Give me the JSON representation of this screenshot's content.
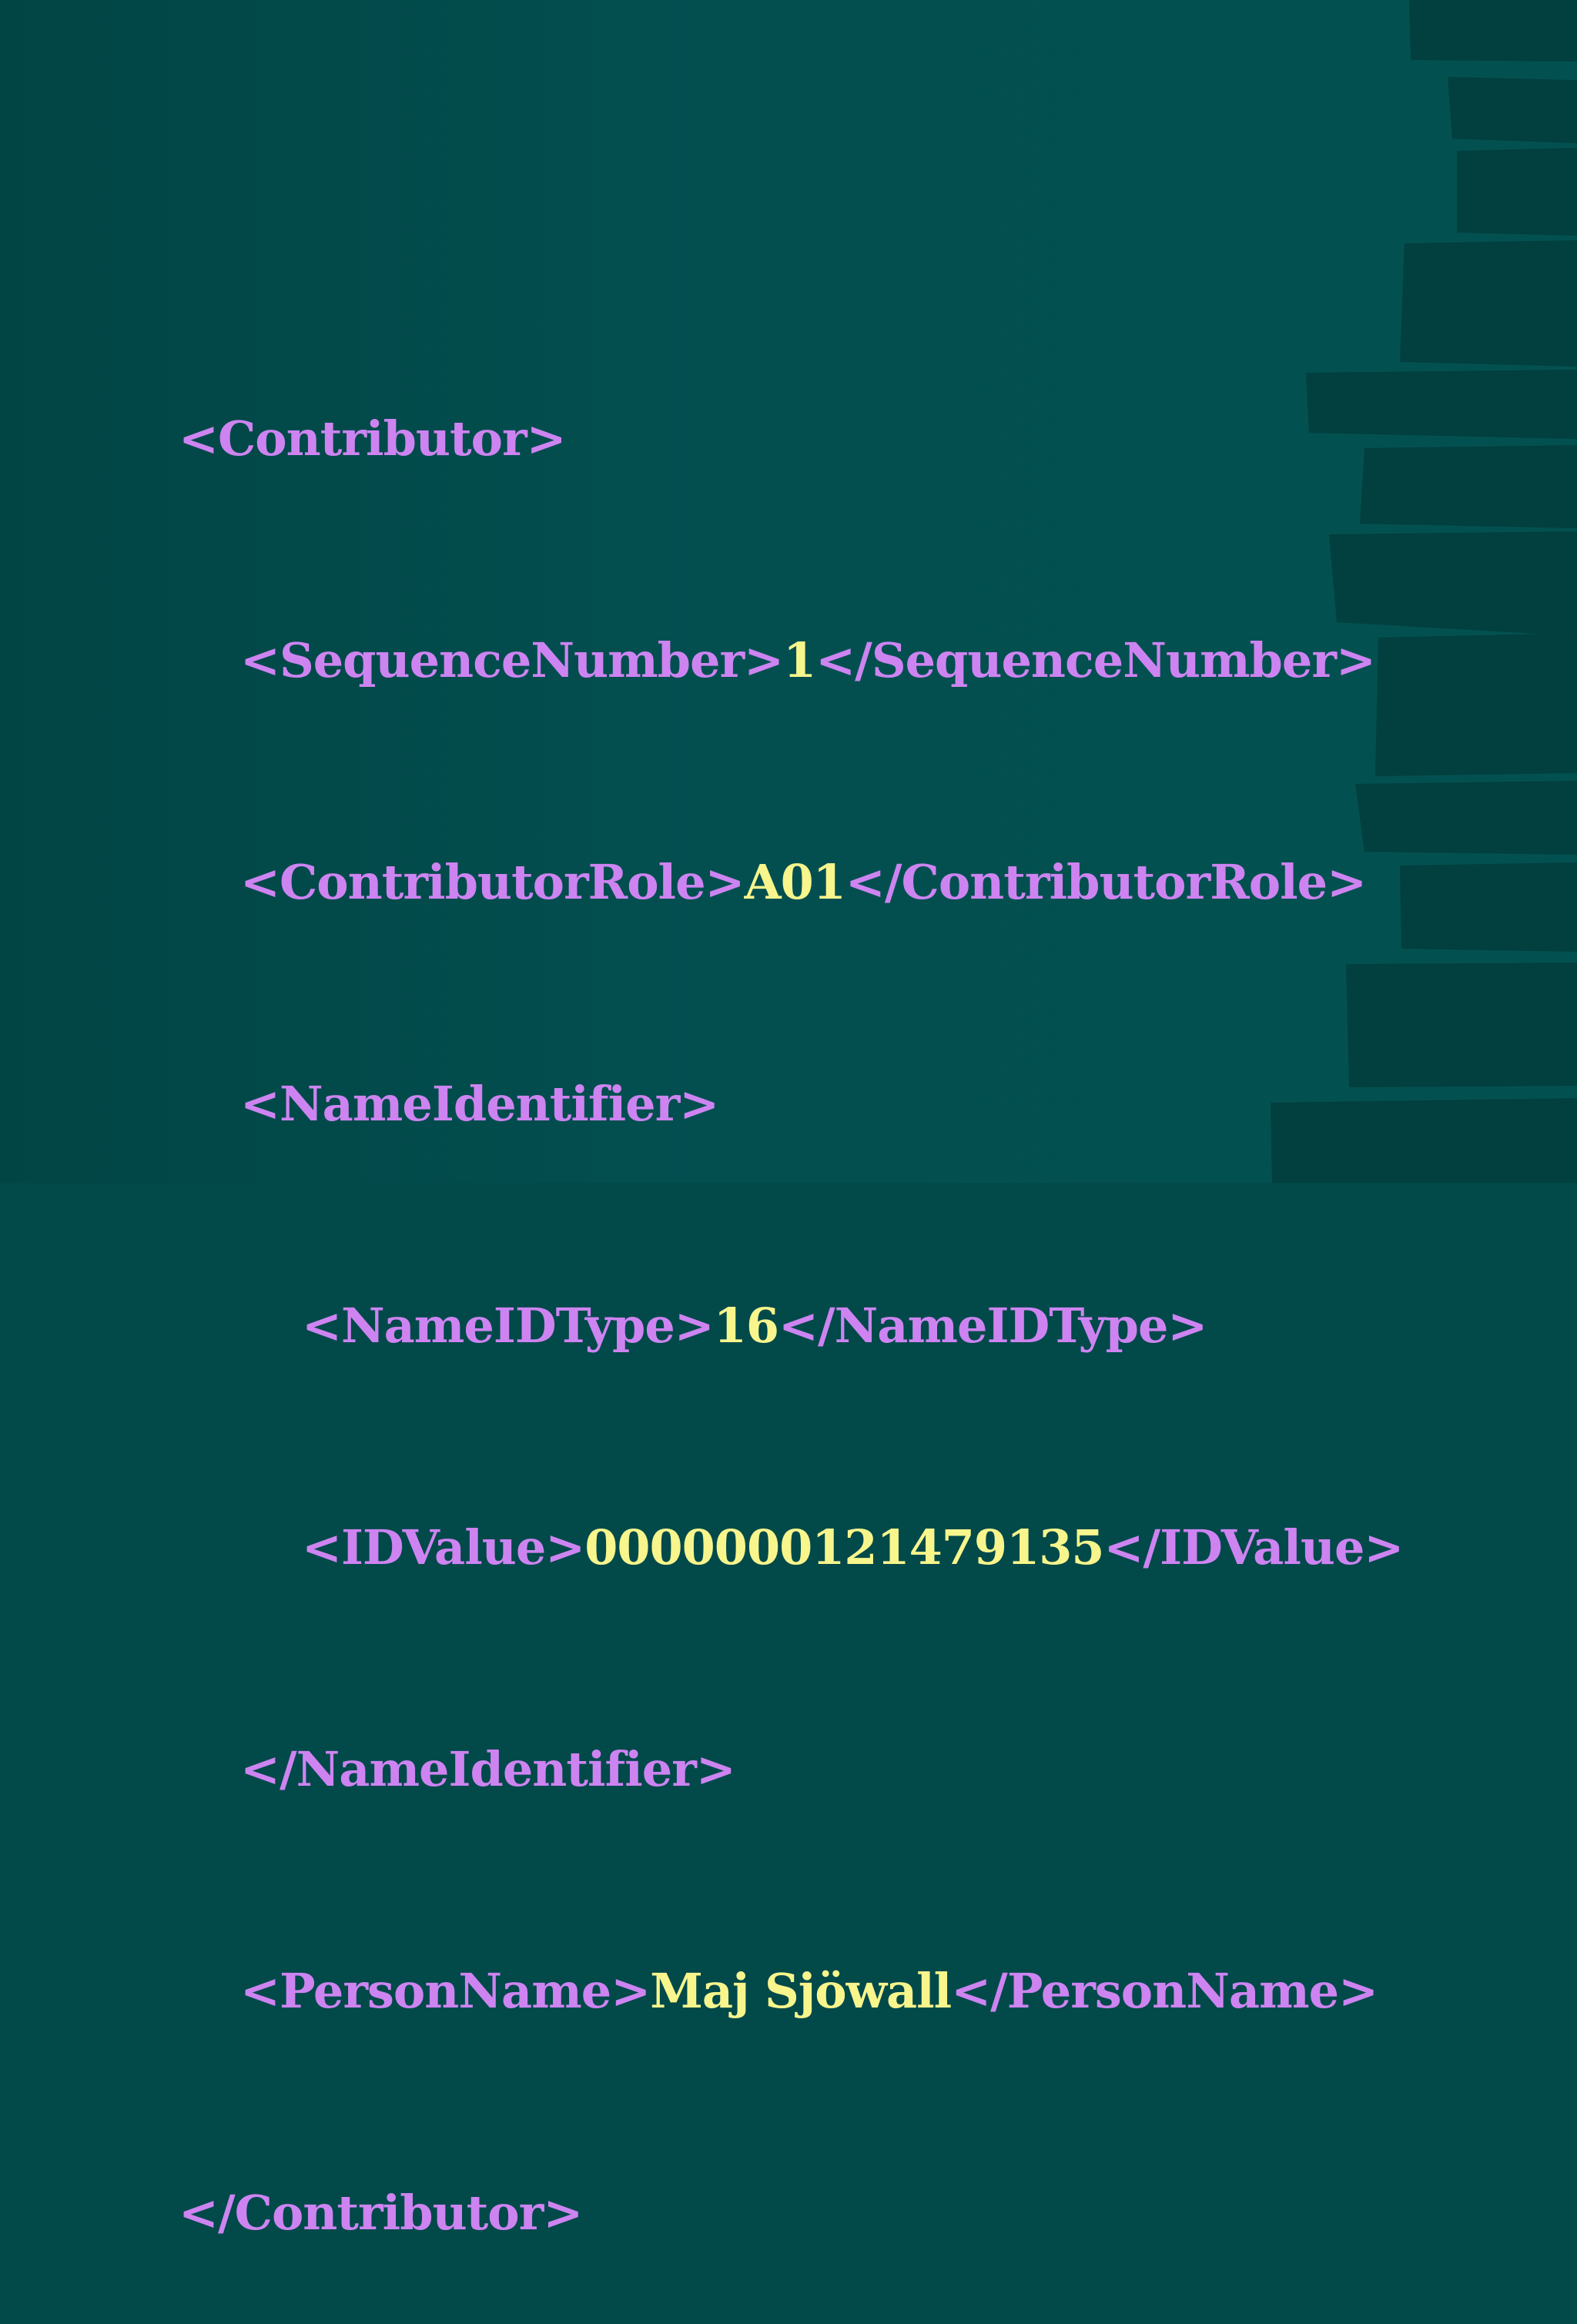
{
  "colors": {
    "background": "#02494a",
    "stripe": "#023d3d",
    "tag": "#cd84f1",
    "value": "#f7f58c"
  },
  "code": {
    "contributor_open": "<Contributor>",
    "sequence_open": "<SequenceNumber>",
    "sequence_value": "1",
    "sequence_close": "</SequenceNumber>",
    "role_open": "<ContributorRole>",
    "role_value": "A01",
    "role_close": "</ContributorRole>",
    "name_identifier_open": "<NameIdentifier>",
    "name_id_type_open": "<NameIDType>",
    "name_id_type_value": "16",
    "name_id_type_close": "</NameIDType>",
    "id_value_open": "<IDValue>",
    "id_value_value": "0000000121479135",
    "id_value_close": "</IDValue>",
    "name_identifier_close": "</NameIdentifier>",
    "person_name_open": "<PersonName>",
    "person_name_value": "Maj Sjöwall",
    "person_name_close": "</PersonName>",
    "contributor_close": "</Contributor>"
  }
}
